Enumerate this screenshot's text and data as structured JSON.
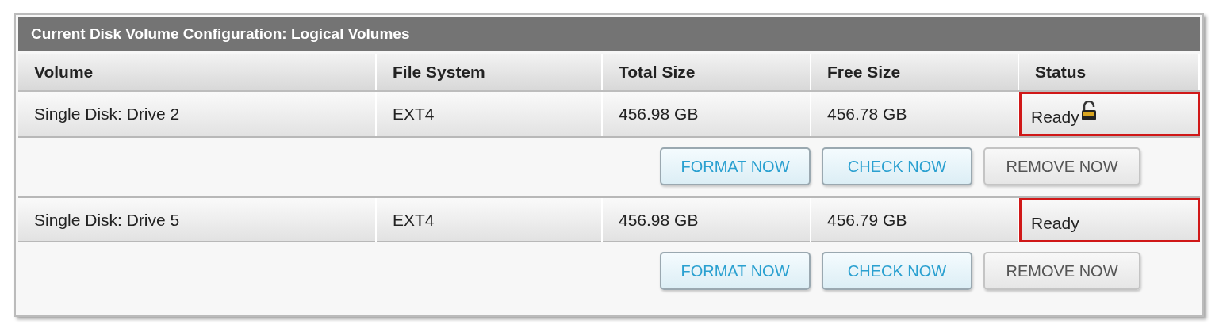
{
  "panel": {
    "title": "Current Disk Volume Configuration: Logical Volumes"
  },
  "table": {
    "columns": [
      "Volume",
      "File System",
      "Total Size",
      "Free Size",
      "Status"
    ],
    "rows": [
      {
        "volume": "Single Disk: Drive 2",
        "file_system": "EXT4",
        "total_size": "456.98 GB",
        "free_size": "456.78 GB",
        "status": "Ready",
        "lock_icon": true,
        "status_highlighted": true,
        "actions": [
          {
            "label": "FORMAT NOW",
            "kind": "accent"
          },
          {
            "label": "CHECK NOW",
            "kind": "accent"
          },
          {
            "label": "REMOVE NOW",
            "kind": "plain"
          }
        ]
      },
      {
        "volume": "Single Disk: Drive 5",
        "file_system": "EXT4",
        "total_size": "456.98 GB",
        "free_size": "456.79 GB",
        "status": "Ready",
        "lock_icon": false,
        "status_highlighted": true,
        "actions": [
          {
            "label": "FORMAT NOW",
            "kind": "accent"
          },
          {
            "label": "CHECK NOW",
            "kind": "accent"
          },
          {
            "label": "REMOVE NOW",
            "kind": "plain"
          }
        ]
      }
    ]
  }
}
